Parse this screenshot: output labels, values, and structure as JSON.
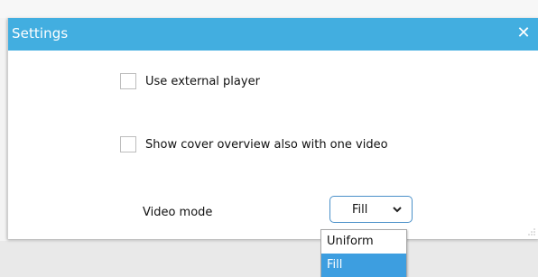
{
  "dialog": {
    "title": "Settings",
    "close_label": "✕"
  },
  "options": {
    "use_external_player": {
      "label": "Use external player",
      "checked": false
    },
    "show_cover_overview": {
      "label": "Show cover overview also with one video",
      "checked": false
    },
    "video_mode": {
      "label": "Video mode",
      "selected": "Fill",
      "choices": [
        "Uniform",
        "Fill"
      ]
    }
  },
  "colors": {
    "titlebar": "#42aee0",
    "selection": "#3d9ee0",
    "select_border": "#4a90c9"
  },
  "icons": {
    "close": "close-icon",
    "dropdown": "chevron-down-icon",
    "resize": "resize-grip-icon"
  }
}
